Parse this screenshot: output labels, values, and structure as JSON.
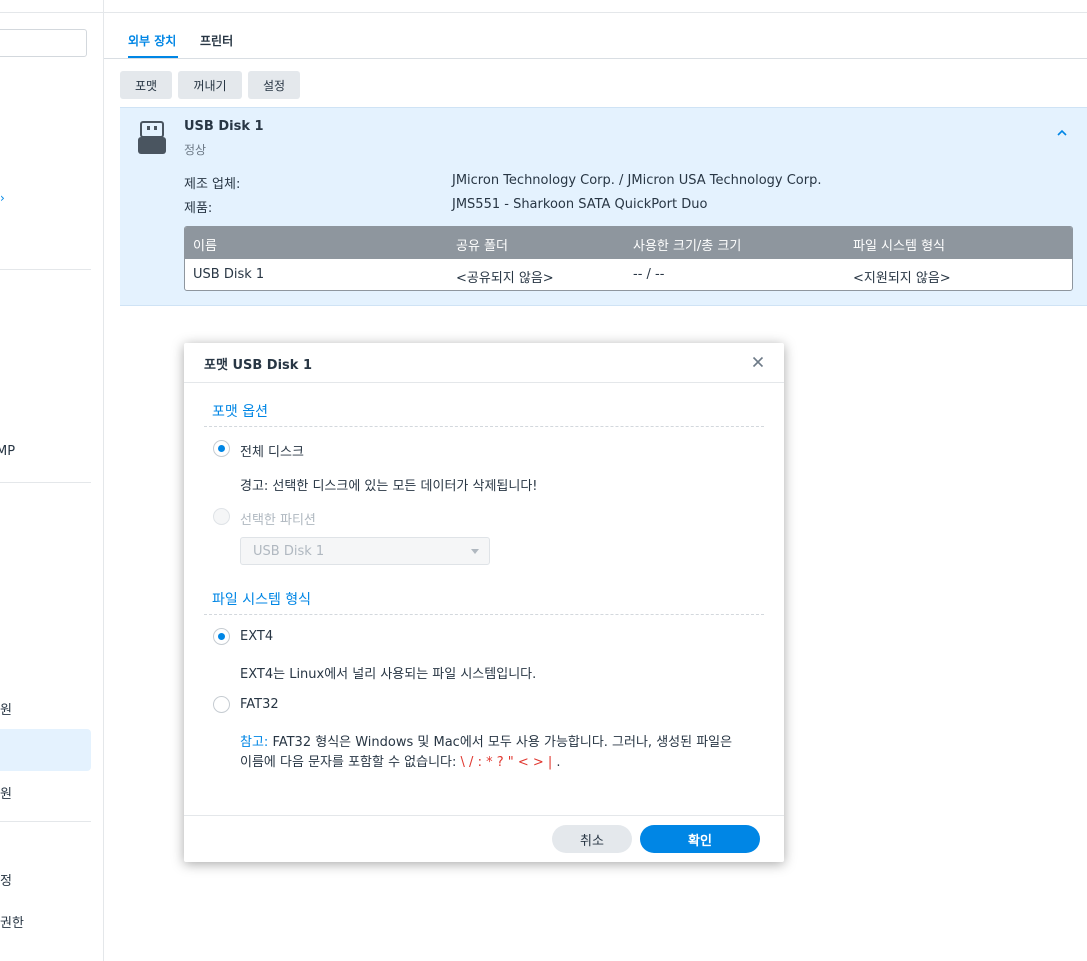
{
  "sidebar": {
    "items": [
      {
        "label": "MP"
      },
      {
        "label": "원"
      },
      {
        "label": "원"
      },
      {
        "label": "정"
      },
      {
        "label": "권한"
      }
    ]
  },
  "tabs": [
    {
      "label": "외부 장치",
      "active": true
    },
    {
      "label": "프린터",
      "active": false
    }
  ],
  "toolbar": {
    "format_label": "포맷",
    "eject_label": "꺼내기",
    "settings_label": "설정"
  },
  "device": {
    "name": "USB Disk 1",
    "status": "정상",
    "manufacturer_label": "제조 업체:",
    "manufacturer_value": "JMicron Technology Corp. / JMicron USA Technology Corp.",
    "product_label": "제품:",
    "product_value": "JMS551 - Sharkoon SATA QuickPort Duo",
    "table": {
      "columns": [
        "이름",
        "공유 폴더",
        "사용한 크기/총 크기",
        "파일 시스템 형식"
      ],
      "rows": [
        [
          "USB Disk 1",
          "<공유되지 않음>",
          "-- / --",
          "<지원되지 않음>"
        ]
      ]
    }
  },
  "modal": {
    "title": "포맷 USB Disk 1",
    "format_options_title": "포맷 옵션",
    "option_whole_disk": "전체 디스크",
    "warning": "경고: 선택한 디스크에 있는 모든 데이터가 삭제됩니다!",
    "option_partition": "선택한 파티션",
    "partition_select_value": "USB Disk 1",
    "fs_title": "파일 시스템 형식",
    "option_ext4": "EXT4",
    "ext4_desc": "EXT4는 Linux에서 널리 사용되는 파일 시스템입니다.",
    "option_fat32": "FAT32",
    "note_label": "참고:",
    "note_text": " FAT32 형식은 Windows 및 Mac에서 모두 사용 가능합니다. 그러나, 생성된 파일은",
    "note_text2": "이름에 다음 문자를 포함할 수 없습니다: ",
    "note_chars": "\\ / : * ? \" < > |",
    "note_end": " .",
    "cancel_label": "취소",
    "ok_label": "확인"
  },
  "colors": {
    "accent": "#0086e5",
    "panel_bg": "#e4f2fe",
    "table_header": "#8e969e",
    "warning_red": "#e0372f"
  }
}
